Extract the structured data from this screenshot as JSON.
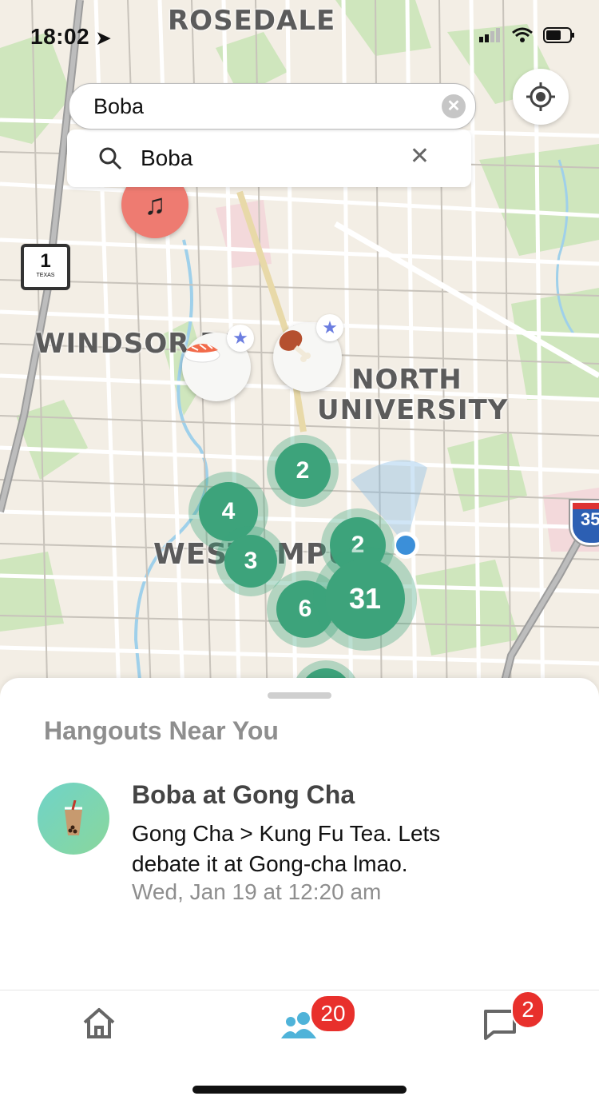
{
  "status_bar": {
    "time": "18:02"
  },
  "map": {
    "labels": {
      "rosedale": "ROSEDALE",
      "windsor": "WINDSOR RO",
      "north": "NORTH",
      "university": "UNIVERSITY",
      "west": "WEST",
      "campus_tail": "MPU",
      "highway": "1",
      "highway_state": "TEXAS",
      "interstate": "35"
    },
    "clusters": [
      {
        "count": "2"
      },
      {
        "count": "4"
      },
      {
        "count": "3"
      },
      {
        "count": "2"
      },
      {
        "count": "6"
      },
      {
        "count": "31"
      }
    ]
  },
  "search": {
    "pill_value": "Boba",
    "box_value": "Boba"
  },
  "sheet": {
    "title": "Hangouts Near You",
    "event": {
      "title": "Boba at Gong Cha",
      "description": "Gong Cha > Kung Fu Tea. Lets debate it at Gong-cha lmao.",
      "time": "Wed, Jan 19 at 12:20 am"
    }
  },
  "tabs": {
    "people_badge": "20",
    "chat_badge": "2"
  },
  "colors": {
    "cluster": "#3da37b",
    "badge": "#e8302c",
    "people_tab": "#4fb3d9",
    "star": "#6b7de0"
  }
}
